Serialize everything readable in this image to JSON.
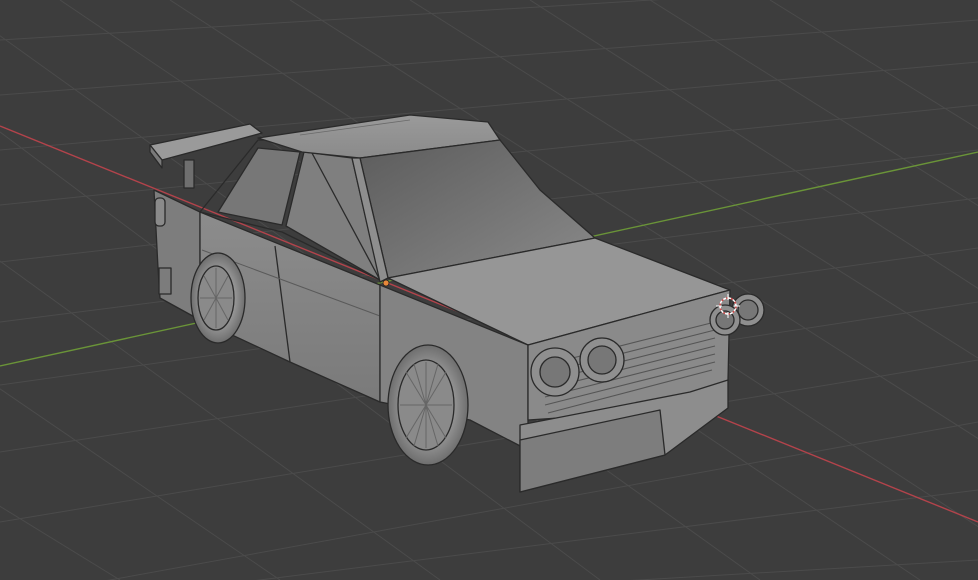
{
  "viewport": {
    "background": "#3d3d3d",
    "grid_color": "#4a4a4a",
    "x_axis_color": "#c0484f",
    "y_axis_color": "#6f9a3a"
  },
  "scene": {
    "object": "low-poly car",
    "shading": "solid",
    "body_color": "#8e8e8e",
    "origin_dot_color": "#e8893a",
    "cursor_icon": "3d-cursor-icon"
  }
}
